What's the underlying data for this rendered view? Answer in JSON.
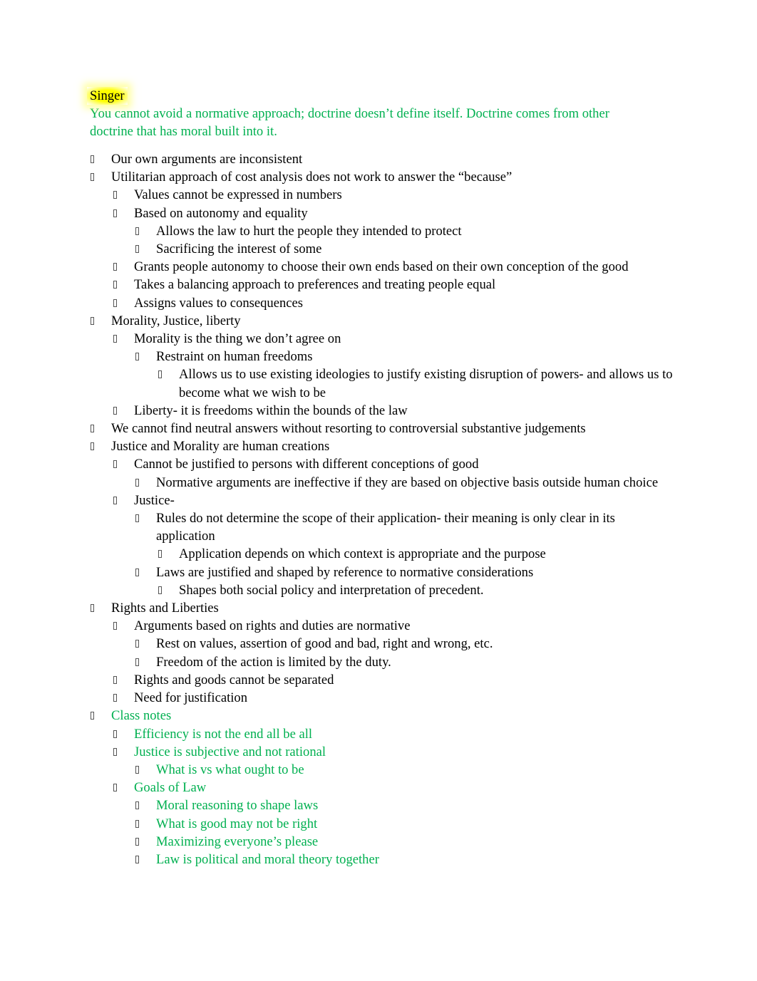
{
  "document": {
    "title": "Singer",
    "intro": "You cannot avoid a normative approach; doctrine doesn’t define itself. Doctrine comes from other doctrine that has moral built into it.",
    "colors": {
      "body_text": "#000000",
      "green_text": "#00b050",
      "highlight": "#ffff00"
    },
    "bullet_icon": "missing-glyph-box",
    "outline": [
      {
        "level": 0,
        "text": "Our own arguments are inconsistent",
        "color": "black"
      },
      {
        "level": 0,
        "text": "Utilitarian approach of cost analysis does not work to answer the “because”",
        "color": "black"
      },
      {
        "level": 1,
        "text": "Values cannot be expressed in numbers",
        "color": "black"
      },
      {
        "level": 1,
        "text": "Based on autonomy and equality",
        "color": "black"
      },
      {
        "level": 2,
        "text": "Allows the law to hurt the people they intended to protect",
        "color": "black"
      },
      {
        "level": 2,
        "text": "Sacrificing the interest of some",
        "color": "black"
      },
      {
        "level": 1,
        "text": "Grants people autonomy to choose their own ends based on their own conception of the good",
        "color": "black"
      },
      {
        "level": 1,
        "text": "Takes a balancing approach to preferences and treating people equal",
        "color": "black"
      },
      {
        "level": 1,
        "text": "Assigns values to consequences",
        "color": "black"
      },
      {
        "level": 0,
        "text": "Morality, Justice, liberty",
        "color": "black"
      },
      {
        "level": 1,
        "text": "Morality is the thing we don’t agree on",
        "color": "black"
      },
      {
        "level": 2,
        "text": "Restraint on human freedoms",
        "color": "black"
      },
      {
        "level": 3,
        "text": "Allows us to use existing ideologies to justify existing disruption of powers- and allows us to become what we wish to be",
        "color": "black"
      },
      {
        "level": 1,
        "text": "Liberty- it is freedoms within the bounds of the law",
        "color": "black"
      },
      {
        "level": 0,
        "text": "We cannot find neutral answers without resorting to controversial substantive judgements",
        "color": "black"
      },
      {
        "level": 0,
        "text": "Justice and Morality are human creations",
        "color": "black"
      },
      {
        "level": 1,
        "text": "Cannot be justified to persons with different conceptions of good",
        "color": "black"
      },
      {
        "level": 2,
        "text": "Normative arguments are ineffective if they are based on objective basis outside human choice",
        "color": "black"
      },
      {
        "level": 1,
        "text": "Justice-",
        "color": "black"
      },
      {
        "level": 2,
        "text": "Rules do not determine the scope of their application- their meaning is only clear in its application",
        "color": "black"
      },
      {
        "level": 3,
        "text": "Application depends on which context is appropriate and the purpose",
        "color": "black"
      },
      {
        "level": 2,
        "text": "Laws are justified and shaped by reference to normative considerations",
        "color": "black"
      },
      {
        "level": 3,
        "text": "Shapes both social policy and interpretation of precedent.",
        "color": "black"
      },
      {
        "level": 0,
        "text": "Rights and Liberties",
        "color": "black"
      },
      {
        "level": 1,
        "text": "Arguments based on rights and duties are normative",
        "color": "black"
      },
      {
        "level": 2,
        "text": "Rest on values, assertion of good and bad, right and wrong, etc.",
        "color": "black"
      },
      {
        "level": 2,
        "text": "Freedom of the action is limited by the duty.",
        "color": "black"
      },
      {
        "level": 1,
        "text": "Rights and goods cannot be separated",
        "color": "black"
      },
      {
        "level": 1,
        "text": "Need for justification",
        "color": "black"
      },
      {
        "level": 0,
        "text": "Class notes",
        "color": "green"
      },
      {
        "level": 1,
        "text": "Efficiency is not the end all be all",
        "color": "green"
      },
      {
        "level": 1,
        "text": "Justice is subjective and not rational",
        "color": "green"
      },
      {
        "level": 2,
        "text": "What is vs what ought to be",
        "color": "green"
      },
      {
        "level": 1,
        "text": "Goals of Law",
        "color": "green"
      },
      {
        "level": 2,
        "text": "Moral reasoning to shape laws",
        "color": "green"
      },
      {
        "level": 2,
        "text": "What is good may not be right",
        "color": "green"
      },
      {
        "level": 2,
        "text": "Maximizing everyone’s please",
        "color": "green"
      },
      {
        "level": 2,
        "text": "Law is political and moral theory together",
        "color": "green"
      }
    ]
  }
}
